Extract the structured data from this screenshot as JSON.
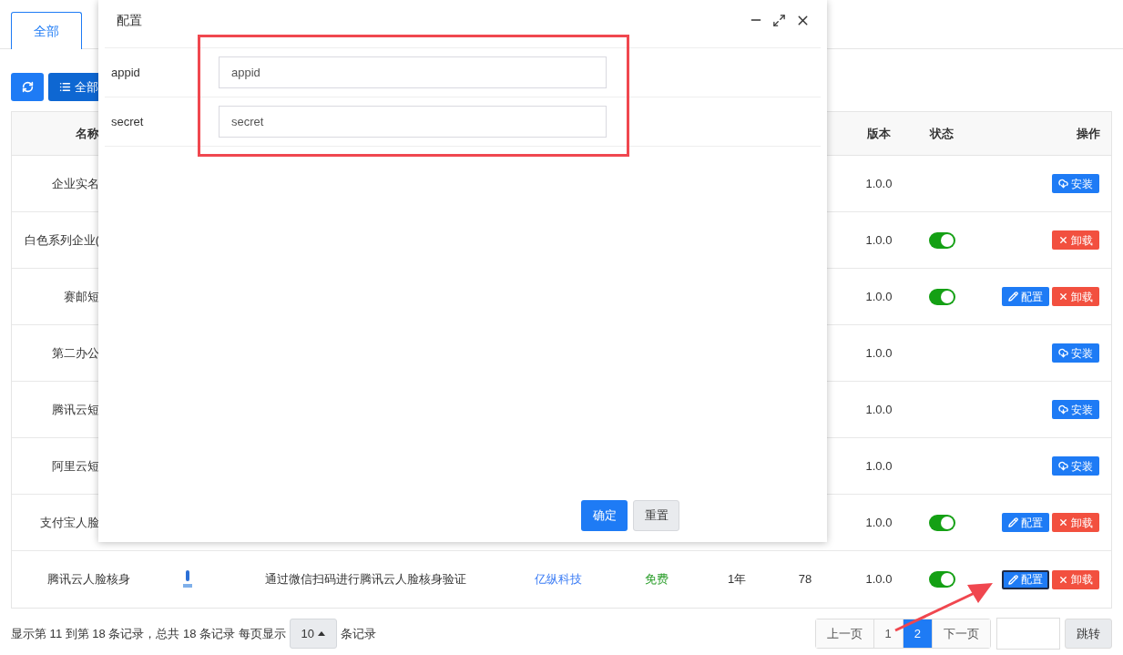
{
  "tabs": [
    {
      "label": "全部",
      "selected": true
    }
  ],
  "toolbar": {
    "all_button": "全部"
  },
  "table": {
    "columns": {
      "name": "名称",
      "version": "版本",
      "status": "状态",
      "actions": "操作"
    },
    "rows": [
      {
        "name": "企业实名",
        "version": "1.0.0",
        "actions": [
          {
            "kind": "install",
            "label": "安装",
            "focused": false
          }
        ]
      },
      {
        "name": "白色系列企业(",
        "version": "1.0.0",
        "switch_on": true,
        "actions": [
          {
            "kind": "uninstall",
            "label": "卸载",
            "focused": false
          }
        ]
      },
      {
        "name": "赛邮短",
        "version": "1.0.0",
        "switch_on": true,
        "actions": [
          {
            "kind": "config",
            "label": "配置",
            "focused": false
          },
          {
            "kind": "uninstall",
            "label": "卸载",
            "focused": false
          }
        ]
      },
      {
        "name": "第二办公",
        "version": "1.0.0",
        "actions": [
          {
            "kind": "install",
            "label": "安装",
            "focused": false
          }
        ]
      },
      {
        "name": "腾讯云短",
        "version": "1.0.0",
        "actions": [
          {
            "kind": "install",
            "label": "安装",
            "focused": false
          }
        ]
      },
      {
        "name": "阿里云短",
        "version": "1.0.0",
        "actions": [
          {
            "kind": "install",
            "label": "安装",
            "focused": false
          }
        ]
      },
      {
        "name": "支付宝人脸",
        "version": "1.0.0",
        "switch_on": true,
        "actions": [
          {
            "kind": "config",
            "label": "配置",
            "focused": false
          },
          {
            "kind": "uninstall",
            "label": "卸载",
            "focused": false
          }
        ]
      },
      {
        "name": "腾讯云人脸核身",
        "description": "通过微信扫码进行腾讯云人脸核身验证",
        "author": "亿纵科技",
        "price": "免费",
        "duration": "1年",
        "count": "78",
        "version": "1.0.0",
        "switch_on": true,
        "actions": [
          {
            "kind": "config",
            "label": "配置",
            "focused": true
          },
          {
            "kind": "uninstall",
            "label": "卸载",
            "focused": false
          }
        ]
      }
    ]
  },
  "footer": {
    "summary": "显示第 11 到第 18 条记录，总共 18 条记录 每页显示",
    "page_size": "10",
    "suffix": "条记录",
    "pagination": [
      {
        "label": "上一页",
        "selected": false
      },
      {
        "label": "1",
        "selected": false
      },
      {
        "label": "2",
        "selected": true
      },
      {
        "label": "下一页",
        "selected": false
      }
    ],
    "jump_button": "跳转"
  },
  "dialog": {
    "title": "配置",
    "fields": [
      {
        "label": "appid",
        "placeholder": "appid"
      },
      {
        "label": "secret",
        "placeholder": "secret"
      }
    ],
    "buttons": [
      {
        "kind": "primary",
        "label": "确定"
      },
      {
        "kind": "default",
        "label": "重置"
      }
    ]
  }
}
